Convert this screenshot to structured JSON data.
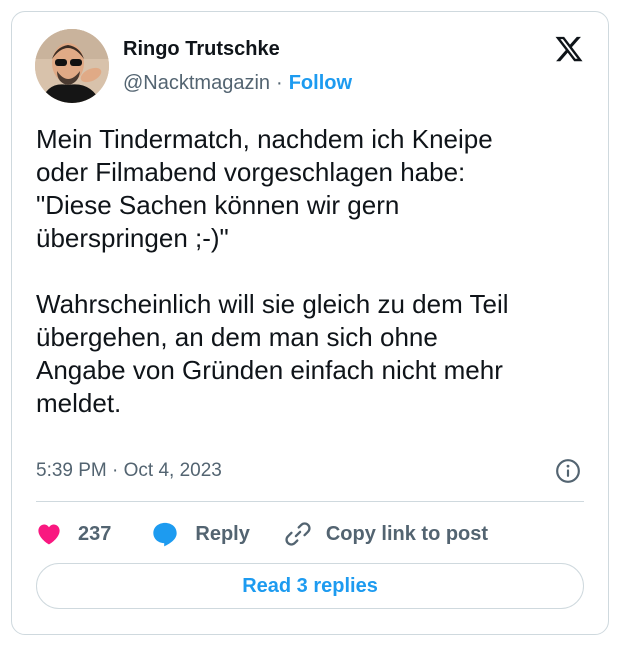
{
  "author": {
    "display_name": "Ringo Trutschke",
    "handle": "@Nacktmagazin",
    "separator": "·",
    "follow_label": "Follow"
  },
  "tweet": {
    "text": "Mein Tindermatch, nachdem ich Kneipe\noder Filmabend vorgeschlagen habe:\n\"Diese Sachen können wir gern\nüberspringen ;-)\"\n\nWahrscheinlich will sie gleich zu dem Teil\nübergehen, an dem man sich ohne\nAngabe von Gründen einfach nicht mehr\nmeldet.",
    "timestamp": "5:39 PM · Oct 4, 2023"
  },
  "actions": {
    "like_count": "237",
    "reply_label": "Reply",
    "copy_link_label": "Copy link to post"
  },
  "footer": {
    "read_replies_label": "Read 3 replies"
  },
  "icons": {
    "logo": "x-logo-icon",
    "info": "info-icon",
    "like": "heart-icon",
    "reply": "speech-bubble-icon",
    "copy": "link-icon"
  },
  "colors": {
    "accent": "#1d9bf0",
    "heart": "#f91880",
    "text": "#0f1419",
    "secondary_text": "#536471",
    "border": "#cfd9de"
  }
}
